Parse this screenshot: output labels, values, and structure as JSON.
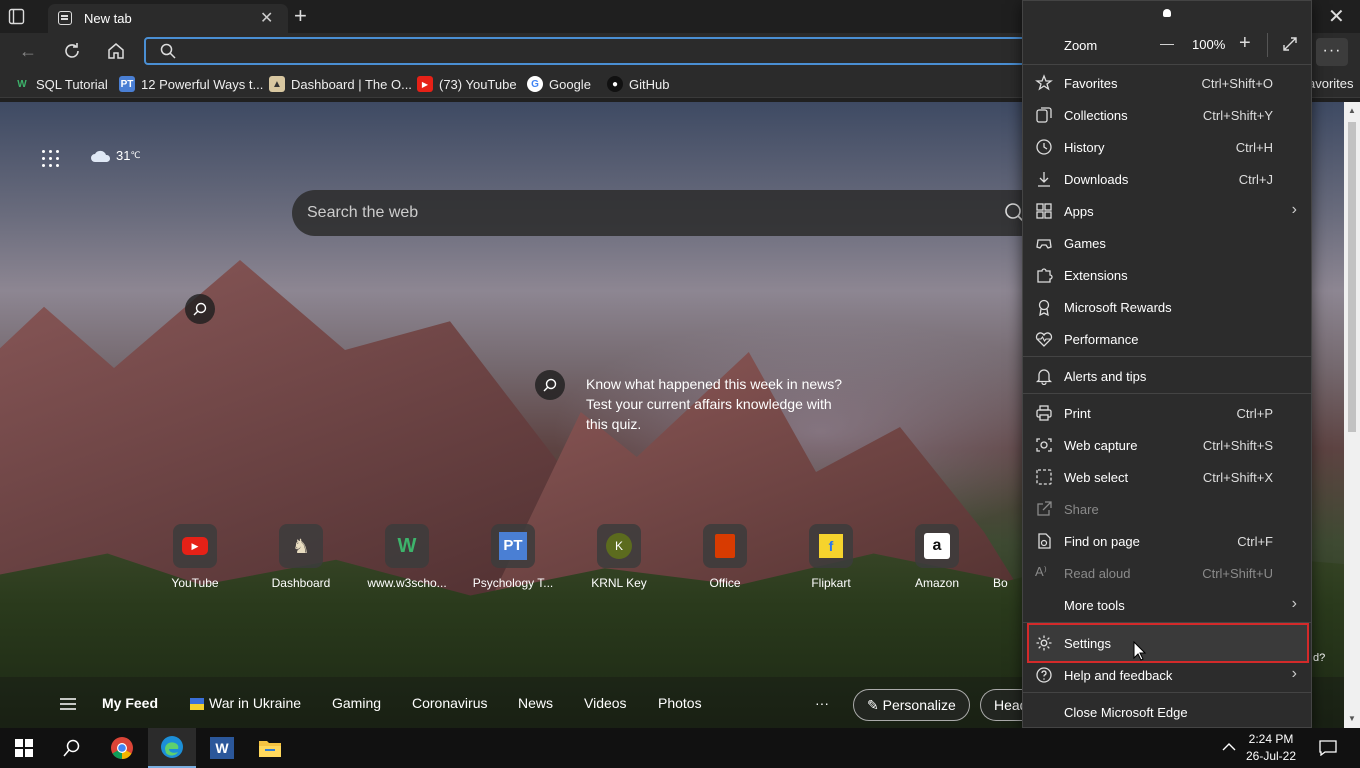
{
  "tabbar": {
    "tab_title": "New tab"
  },
  "favorites": {
    "items": [
      "SQL Tutorial",
      "12 Powerful Ways t...",
      "Dashboard | The O...",
      "(73) YouTube",
      "Google",
      "GitHub"
    ],
    "overflow_label": "avorites"
  },
  "newtab": {
    "weather": "31",
    "weather_unit": "℃",
    "search_placeholder": "Search the web",
    "quiz_text": "Know what happened this week in news? Test your current affairs knowledge with this quiz.",
    "tiles": [
      "YouTube",
      "Dashboard",
      "www.w3scho...",
      "Psychology T...",
      "KRNL Key",
      "Office",
      "Flipkart",
      "Amazon",
      "Bo"
    ],
    "feed": {
      "my_feed": "My Feed",
      "items": [
        "War in Ukraine",
        "Gaming",
        "Coronavirus",
        "News",
        "Videos",
        "Photos"
      ],
      "more": "···",
      "personalize": "Personalize",
      "heading_partial": "Head"
    },
    "side_text": "d?"
  },
  "menu": {
    "zoom_label": "Zoom",
    "zoom_value": "100%",
    "zoom_minus": "—",
    "zoom_plus": "+",
    "items": [
      {
        "label": "Favorites",
        "shortcut": "Ctrl+Shift+O"
      },
      {
        "label": "Collections",
        "shortcut": "Ctrl+Shift+Y"
      },
      {
        "label": "History",
        "shortcut": "Ctrl+H"
      },
      {
        "label": "Downloads",
        "shortcut": "Ctrl+J"
      },
      {
        "label": "Apps",
        "shortcut": ""
      },
      {
        "label": "Games",
        "shortcut": ""
      },
      {
        "label": "Extensions",
        "shortcut": ""
      },
      {
        "label": "Microsoft Rewards",
        "shortcut": ""
      },
      {
        "label": "Performance",
        "shortcut": ""
      },
      {
        "label": "Alerts and tips",
        "shortcut": ""
      },
      {
        "label": "Print",
        "shortcut": "Ctrl+P"
      },
      {
        "label": "Web capture",
        "shortcut": "Ctrl+Shift+S"
      },
      {
        "label": "Web select",
        "shortcut": "Ctrl+Shift+X"
      },
      {
        "label": "Share",
        "shortcut": ""
      },
      {
        "label": "Find on page",
        "shortcut": "Ctrl+F"
      },
      {
        "label": "Read aloud",
        "shortcut": "Ctrl+Shift+U"
      },
      {
        "label": "More tools",
        "shortcut": ""
      },
      {
        "label": "Settings",
        "shortcut": ""
      },
      {
        "label": "Help and feedback",
        "shortcut": ""
      },
      {
        "label": "Close Microsoft Edge",
        "shortcut": ""
      }
    ]
  },
  "taskbar": {
    "time": "2:24 PM",
    "date": "26-Jul-22"
  },
  "colors": {
    "accent": "#4a8fd4",
    "highlight_border": "#d42a2a"
  }
}
